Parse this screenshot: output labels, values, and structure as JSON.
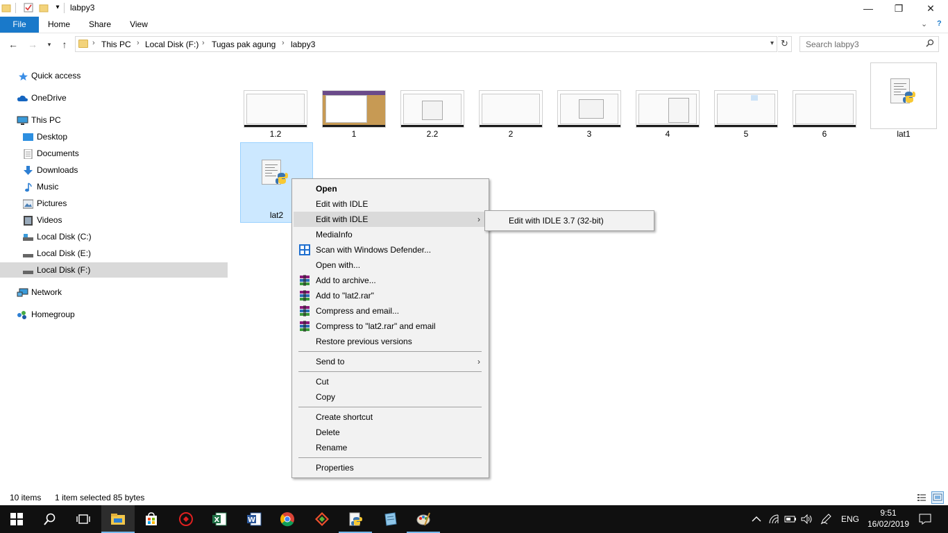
{
  "window": {
    "title": "labpy3",
    "minimize_glyph": "—",
    "maximize_glyph": "❐",
    "close_glyph": "✕"
  },
  "ribbon": {
    "tabs": [
      "File",
      "Home",
      "Share",
      "View"
    ]
  },
  "address": {
    "crumbs": [
      "This PC",
      "Local Disk (F:)",
      "Tugas pak agung",
      "labpy3"
    ],
    "search_placeholder": "Search labpy3"
  },
  "navigation": {
    "items": [
      {
        "label": "Quick access",
        "icon": "star-icon"
      },
      {
        "label": "OneDrive",
        "icon": "cloud-icon"
      },
      {
        "label": "This PC",
        "icon": "computer-icon"
      },
      {
        "label": "Desktop",
        "icon": "desktop-icon"
      },
      {
        "label": "Documents",
        "icon": "documents-icon"
      },
      {
        "label": "Downloads",
        "icon": "download-icon"
      },
      {
        "label": "Music",
        "icon": "music-icon"
      },
      {
        "label": "Pictures",
        "icon": "pictures-icon"
      },
      {
        "label": "Videos",
        "icon": "videos-icon"
      },
      {
        "label": "Local Disk (C:)",
        "icon": "drive-icon"
      },
      {
        "label": "Local Disk (E:)",
        "icon": "drive-icon"
      },
      {
        "label": "Local Disk (F:)",
        "icon": "drive-icon",
        "selected": true
      },
      {
        "label": "Network",
        "icon": "network-icon"
      },
      {
        "label": "Homegroup",
        "icon": "homegroup-icon"
      }
    ]
  },
  "files": {
    "items": [
      "1.2",
      "1",
      "2.2",
      "2",
      "3",
      "4",
      "5",
      "6",
      "lat1",
      "lat2"
    ],
    "selected": "lat2"
  },
  "status": {
    "count": "10 items",
    "selection": "1 item selected  85 bytes"
  },
  "context_menu": {
    "items": [
      "Open",
      "Edit with IDLE",
      "Edit with IDLE",
      "MediaInfo",
      "Scan with Windows Defender...",
      "Open with...",
      "Add to archive...",
      "Add to \"lat2.rar\"",
      "Compress and email...",
      "Compress to \"lat2.rar\" and email",
      "Restore previous versions",
      "Send to",
      "Cut",
      "Copy",
      "Create shortcut",
      "Delete",
      "Rename",
      "Properties"
    ],
    "submenu_item": "Edit with IDLE 3.7 (32-bit)"
  },
  "taskbar": {
    "language": "ENG",
    "time": "9:51",
    "date": "16/02/2019"
  },
  "colors": {
    "accent": "#1979ca",
    "selection": "#cce8ff",
    "taskbar": "#101010"
  }
}
